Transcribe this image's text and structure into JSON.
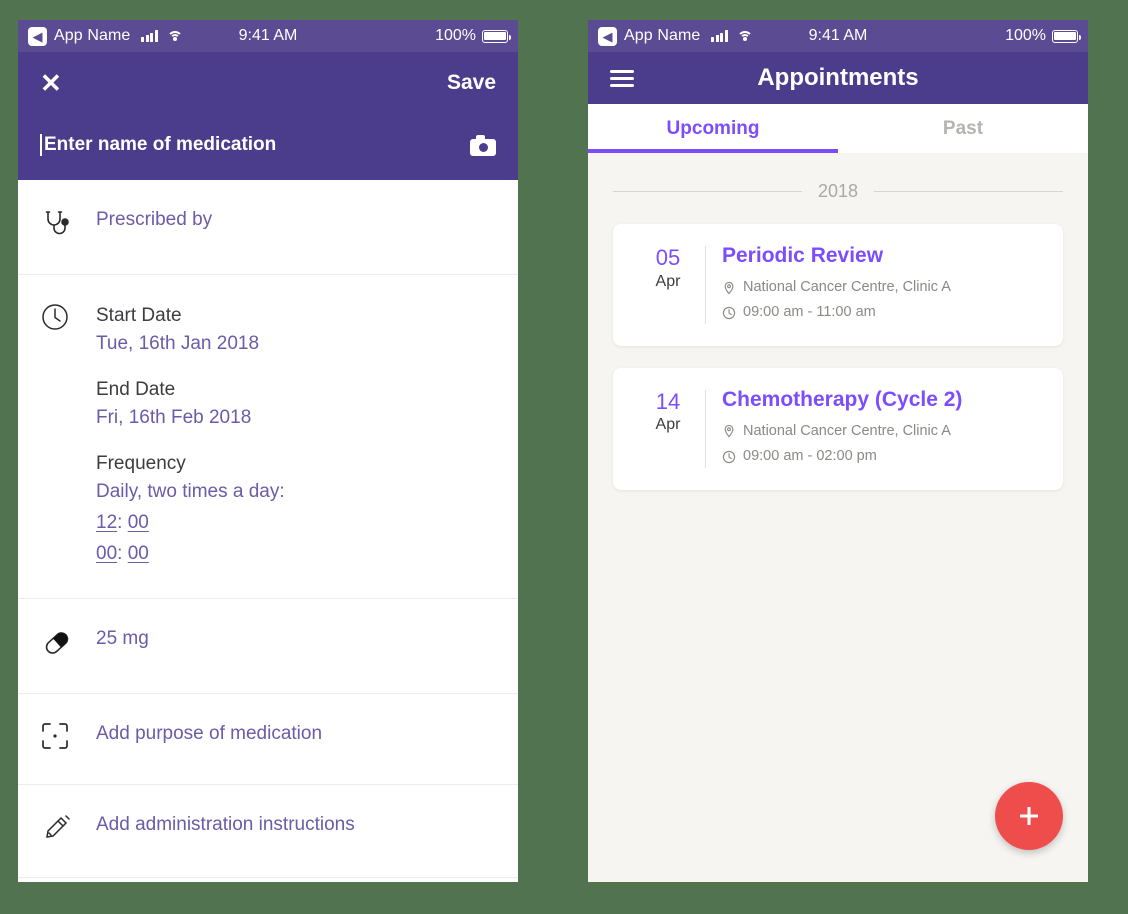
{
  "theme": {
    "page_background": "#52734F",
    "statusbar_purple": "#5B4B93",
    "navbar_purple": "#4C3C8C",
    "accent_violet": "#7C4DFF",
    "link_purple": "#6B5BA8",
    "fab_red": "#EF4C4C",
    "appt_background": "#F7F5F1"
  },
  "status_bar": {
    "back_icon": "back-chevron-icon",
    "app_name": "App Name",
    "signal_icon": "signal-bars-icon",
    "wifi_icon": "wifi-icon",
    "time": "9:41 AM",
    "battery_percent": "100%",
    "battery_icon": "battery-full-icon"
  },
  "medication_screen": {
    "navbar": {
      "close_icon": "close-icon",
      "close_label": "✕",
      "save_label": "Save"
    },
    "name_field": {
      "placeholder": "Enter name of medication",
      "value": "",
      "camera_icon": "camera-icon"
    },
    "rows": [
      {
        "icon": "stethoscope-icon",
        "label": "Prescribed by"
      },
      {
        "icon": "clock-icon",
        "start_date_label": "Start Date",
        "start_date_value": "Tue, 16th Jan 2018",
        "end_date_label": "End Date",
        "end_date_value": "Fri, 16th Feb 2018",
        "frequency_label": "Frequency",
        "frequency_value": "Daily, two times a day:",
        "times": [
          {
            "hours": "12",
            "separator": ":",
            "minutes": "00"
          },
          {
            "hours": "00",
            "separator": ":",
            "minutes": "00"
          }
        ]
      },
      {
        "icon": "pill-icon",
        "label": "25 mg"
      },
      {
        "icon": "scan-target-icon",
        "label": "Add purpose of medication"
      },
      {
        "icon": "syringe-icon",
        "label": "Add administration instructions"
      }
    ]
  },
  "appointments_screen": {
    "navbar": {
      "menu_icon": "hamburger-menu-icon",
      "title": "Appointments"
    },
    "tabs": [
      {
        "label": "Upcoming",
        "active": true
      },
      {
        "label": "Past",
        "active": false
      }
    ],
    "year_divider": "2018",
    "appointments": [
      {
        "day": "05",
        "month": "Apr",
        "title": "Periodic Review",
        "location_icon": "location-pin-icon",
        "location": "National Cancer Centre, Clinic A",
        "time_icon": "clock-icon",
        "time": "09:00 am - 11:00 am"
      },
      {
        "day": "14",
        "month": "Apr",
        "title": "Chemotherapy (Cycle 2)",
        "location_icon": "location-pin-icon",
        "location": "National Cancer Centre, Clinic A",
        "time_icon": "clock-icon",
        "time": "09:00 am - 02:00 pm"
      }
    ],
    "fab": {
      "icon": "plus-icon",
      "label": "+"
    }
  }
}
